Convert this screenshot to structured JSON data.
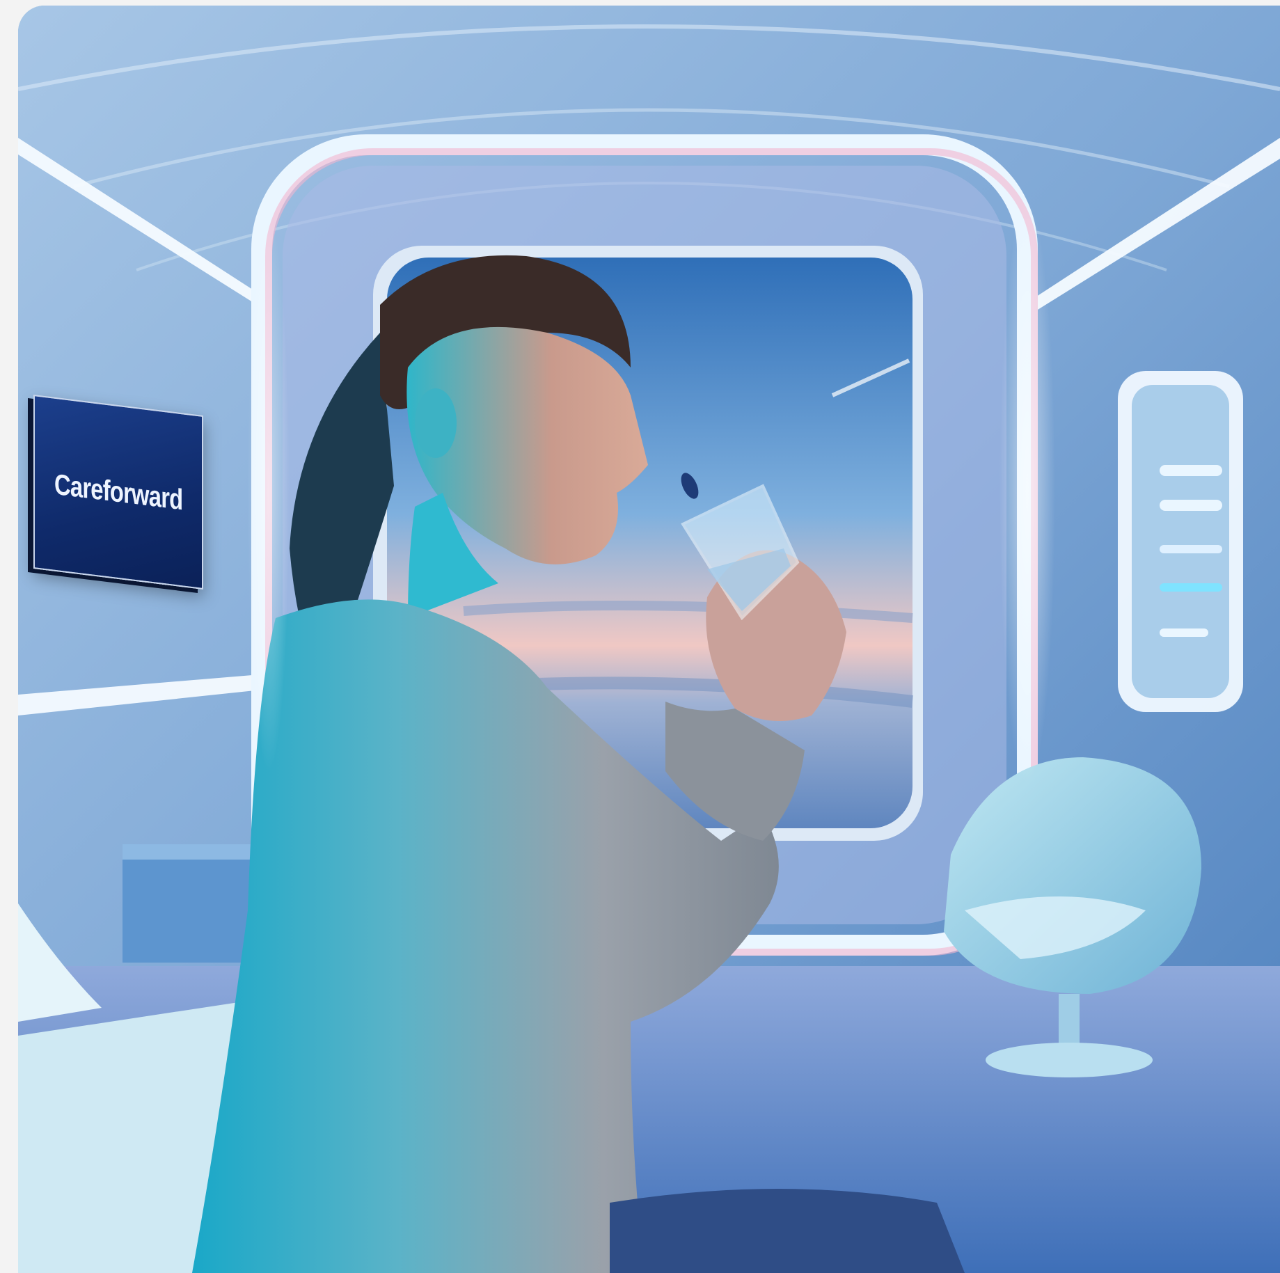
{
  "image": {
    "description_free": true
  },
  "wall_sign": {
    "text": "Careforward"
  },
  "colors": {
    "room_base": "#8fb4d8",
    "neon_glow": "#e9f4ff",
    "neon_pink": "#f2b6c8",
    "sky_top": "#3d7ec4",
    "sky_horizon": "#f2c9c6",
    "sweater": "#8e97a3",
    "sign_bg": "#15347a"
  }
}
